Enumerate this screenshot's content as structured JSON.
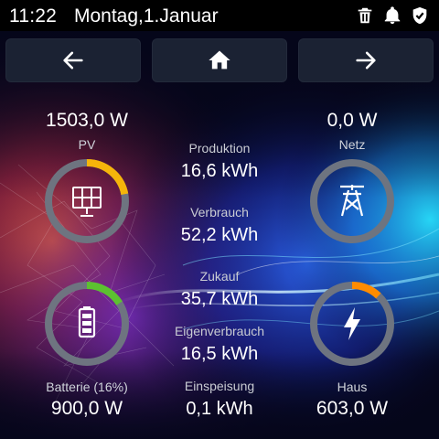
{
  "status": {
    "time": "11:22",
    "date": "Montag,1.Januar",
    "icons": [
      "trash-icon",
      "bell-icon",
      "shield-check-icon"
    ]
  },
  "nav": {
    "icons": [
      "arrow-left-icon",
      "home-icon",
      "arrow-right-icon"
    ]
  },
  "pv": {
    "value": "1503,0 W",
    "label": "PV",
    "icon": "solar-panel-icon",
    "ring_fraction": 0.22,
    "ring_color": "#f5b50a"
  },
  "netz": {
    "value": "0,0 W",
    "label": "Netz",
    "icon": "power-tower-icon",
    "ring_fraction": 0,
    "ring_color": "#f5b50a"
  },
  "batterie": {
    "value": "900,0 W",
    "label": "Batterie (16%)",
    "icon": "battery-icon",
    "ring_fraction": 0.16,
    "ring_color": "#5cc130"
  },
  "haus": {
    "value": "603,0 W",
    "label": "Haus",
    "icon": "lightning-icon",
    "ring_fraction": 0.12,
    "ring_color": "#ff8c00"
  },
  "center": {
    "produktion": {
      "label": "Produktion",
      "value": "16,6 kWh"
    },
    "verbrauch": {
      "label": "Verbrauch",
      "value": "52,2 kWh"
    },
    "zukauf": {
      "label": "Zukauf",
      "value": "35,7 kWh"
    },
    "eigenverbrauch": {
      "label": "Eigenverbrauch",
      "value": "16,5 kWh"
    },
    "einspeisung": {
      "label": "Einspeisung",
      "value": "0,1 kWh"
    }
  },
  "colors": {
    "ring_track": "#6e7480",
    "nav_bg": "#1b2233"
  }
}
